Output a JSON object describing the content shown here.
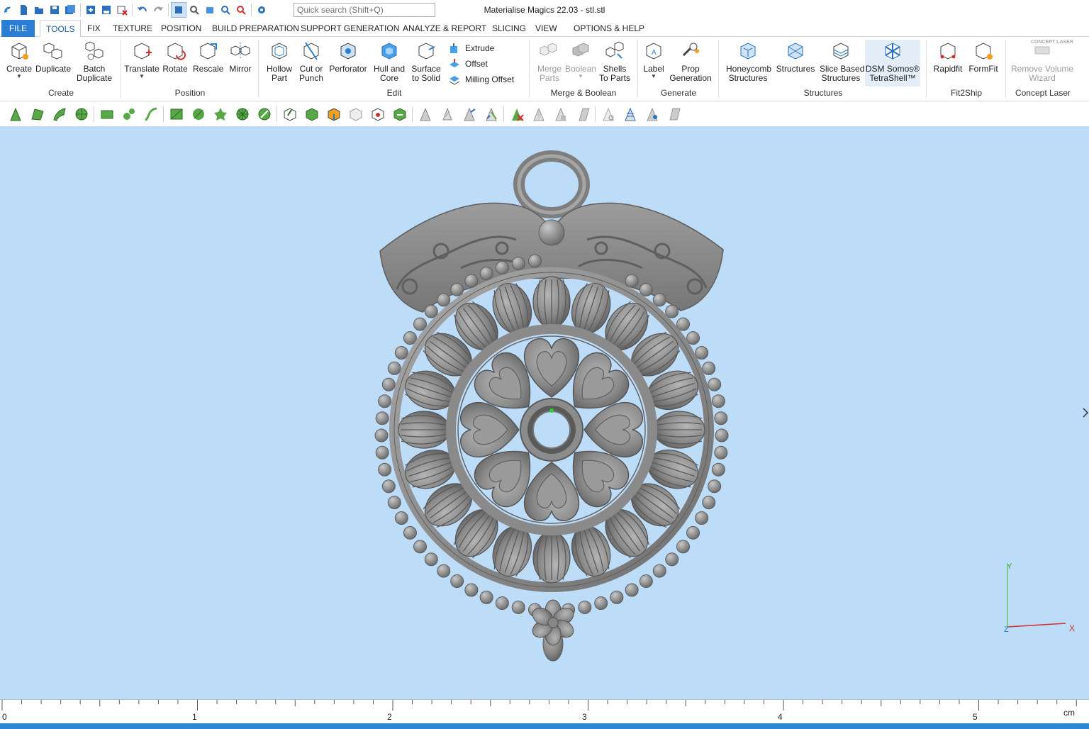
{
  "window": {
    "title": "Materialise Magics 22.03 - stl.stl"
  },
  "quick_search": {
    "placeholder": "Quick search (Shift+Q)"
  },
  "tabs": [
    "FILE",
    "TOOLS",
    "FIX",
    "TEXTURE",
    "POSITION",
    "BUILD PREPARATION",
    "SUPPORT GENERATION",
    "ANALYZE & REPORT",
    "SLICING",
    "VIEW",
    "OPTIONS & HELP"
  ],
  "ribbon": {
    "create": {
      "label": "Create",
      "buttons": [
        "Create",
        "Duplicate",
        "Batch",
        "Duplicate"
      ]
    },
    "position": {
      "label": "Position",
      "buttons": [
        "Translate",
        "Rotate",
        "Rescale",
        "Mirror"
      ]
    },
    "edit": {
      "label": "Edit",
      "buttons": [
        "Hollow",
        "Part",
        "Cut or",
        "Punch",
        "Perforator",
        "Hull and",
        "Core",
        "Surface",
        "to Solid"
      ],
      "small": [
        "Extrude",
        "Offset",
        "Milling Offset"
      ]
    },
    "merge": {
      "label": "Merge & Boolean",
      "buttons": [
        "Merge",
        "Parts",
        "Boolean",
        "Shells",
        "To Parts"
      ]
    },
    "generate": {
      "label": "Generate",
      "buttons": [
        "Label",
        "Prop",
        "Generation"
      ]
    },
    "structures": {
      "label": "Structures",
      "buttons": [
        "Honeycomb",
        "Structures",
        "Structures",
        "Slice Based",
        "Structures",
        "DSM Somos®",
        "TetraShell™"
      ]
    },
    "fit2ship": {
      "label": "Fit2Ship",
      "buttons": [
        "Rapidfit",
        "FormFit"
      ]
    },
    "concept": {
      "label": "Concept Laser",
      "buttons": [
        "Remove Volume",
        "Wizard"
      ],
      "logo": "CONCEPT LASER"
    }
  },
  "axes": {
    "y": "Y",
    "x": "X",
    "z": "Z"
  },
  "ruler": {
    "labels": [
      "0",
      "1",
      "2",
      "3",
      "4",
      "5"
    ],
    "unit": "cm"
  },
  "colors": {
    "accent": "#2a7fd4",
    "viewport": "#bcdcf8",
    "model": "#8c8c8c"
  }
}
